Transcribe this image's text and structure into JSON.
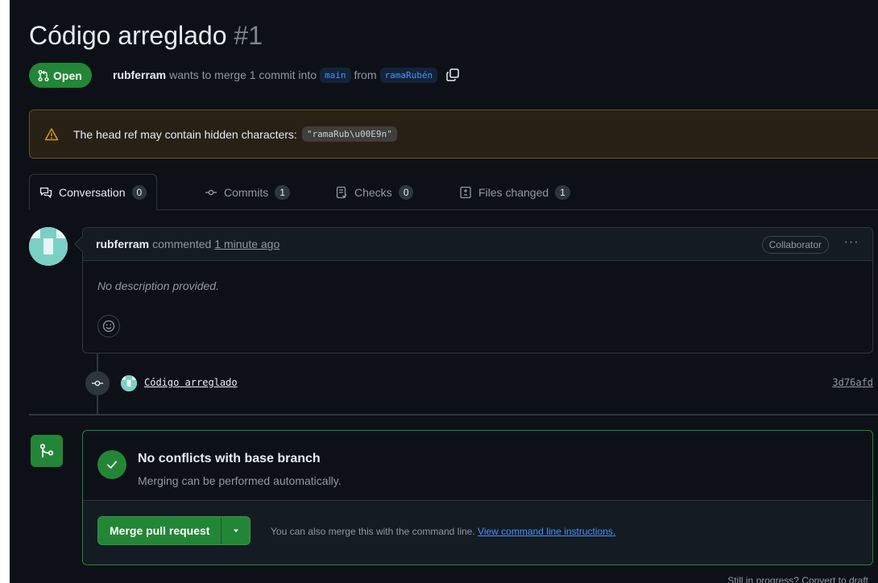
{
  "pull_request": {
    "title": "Código arreglado",
    "number": "#1",
    "state": "Open",
    "author": "rubferram",
    "meta_text": "wants to merge 1 commit into",
    "base_branch": "main",
    "from_text": "from",
    "head_branch": "ramaRubén"
  },
  "warning": {
    "text": "The head ref may contain hidden characters:",
    "code": "\"ramaRub\\u00E9n\""
  },
  "tabs": [
    {
      "label": "Conversation",
      "count": "0"
    },
    {
      "label": "Commits",
      "count": "1"
    },
    {
      "label": "Checks",
      "count": "0"
    },
    {
      "label": "Files changed",
      "count": "1"
    }
  ],
  "comment": {
    "author": "rubferram",
    "verb": "commented",
    "time": "1 minute ago",
    "role": "Collaborator",
    "more": "···",
    "body": "No description provided."
  },
  "commit": {
    "message": "Código arreglado",
    "sha": "3d76afd"
  },
  "merge": {
    "heading": "No conflicts with base branch",
    "subtext": "Merging can be performed automatically.",
    "button_label": "Merge pull request",
    "hint_text": "You can also merge this with the command line.",
    "hint_link": "View command line instructions."
  },
  "draft": {
    "text": "Still in progress?",
    "link": "Convert to draft"
  },
  "colors": {
    "background": "#0d1117",
    "success": "#238636",
    "accent_link": "#4493f8",
    "warning_border": "#6a5215"
  }
}
